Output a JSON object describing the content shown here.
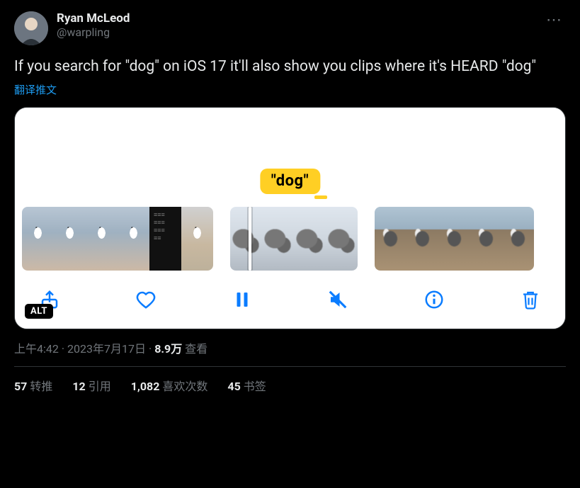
{
  "author": {
    "display_name": "Ryan McLeod",
    "handle": "@warpling"
  },
  "more_label": "⋯",
  "tweet_text": "If you search for \"dog\" on iOS 17 it'll also show you clips where it's HEARD \"dog\"",
  "translate_label": "翻译推文",
  "media": {
    "search_chip": "\"dog\"",
    "alt_badge": "ALT",
    "toolbar": {
      "share": "share-icon",
      "like": "heart-icon",
      "pause": "pause-icon",
      "mute": "mute-icon",
      "info": "info-icon",
      "trash": "trash-icon"
    }
  },
  "meta": {
    "time": "上午4:42",
    "date": "2023年7月17日",
    "views_number": "8.9万",
    "views_label": "查看"
  },
  "stats": {
    "retweets_num": "57",
    "retweets_label": "转推",
    "quotes_num": "12",
    "quotes_label": "引用",
    "likes_num": "1,082",
    "likes_label": "喜欢次数",
    "bookmarks_num": "45",
    "bookmarks_label": "书签"
  }
}
